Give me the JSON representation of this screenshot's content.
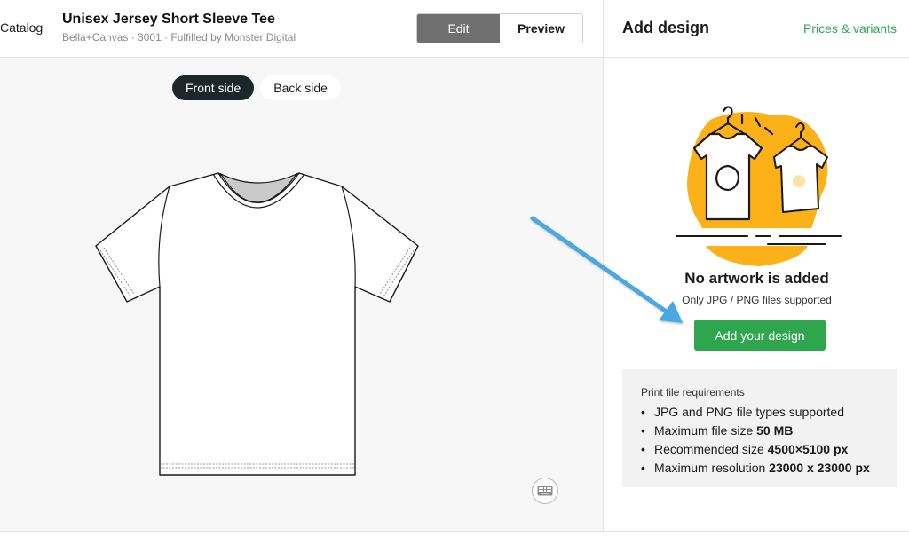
{
  "header": {
    "catalog_label": "Catalog",
    "product_title": "Unisex Jersey Short Sleeve Tee",
    "product_subtitle": "Bella+Canvas · 3001 · Fulfilled by Monster Digital",
    "mode_tabs": [
      {
        "label": "Edit",
        "active": true
      },
      {
        "label": "Preview",
        "active": false
      }
    ]
  },
  "canvas": {
    "side_tabs": [
      {
        "label": "Front side",
        "active": true
      },
      {
        "label": "Back side",
        "active": false
      }
    ],
    "keyboard_icon": "keyboard-icon"
  },
  "panel": {
    "title": "Add design",
    "prices_link": "Prices & variants",
    "empty_title": "No artwork is added",
    "empty_subtitle": "Only JPG / PNG files supported",
    "add_button": "Add your design",
    "requirements": {
      "title": "Print file requirements",
      "items": [
        {
          "text": "JPG and PNG file types supported",
          "bold": ""
        },
        {
          "text": "Maximum file size ",
          "bold": "50 MB"
        },
        {
          "text": "Recommended size ",
          "bold": "4500×5100 px"
        },
        {
          "text": "Maximum resolution ",
          "bold": "23000 x 23000 px"
        }
      ]
    }
  },
  "colors": {
    "accent_green": "#2ea64e",
    "dark_toggle": "#1d2628",
    "illustration_yellow": "#fbb117",
    "arrow_blue": "#4aa8e0"
  }
}
